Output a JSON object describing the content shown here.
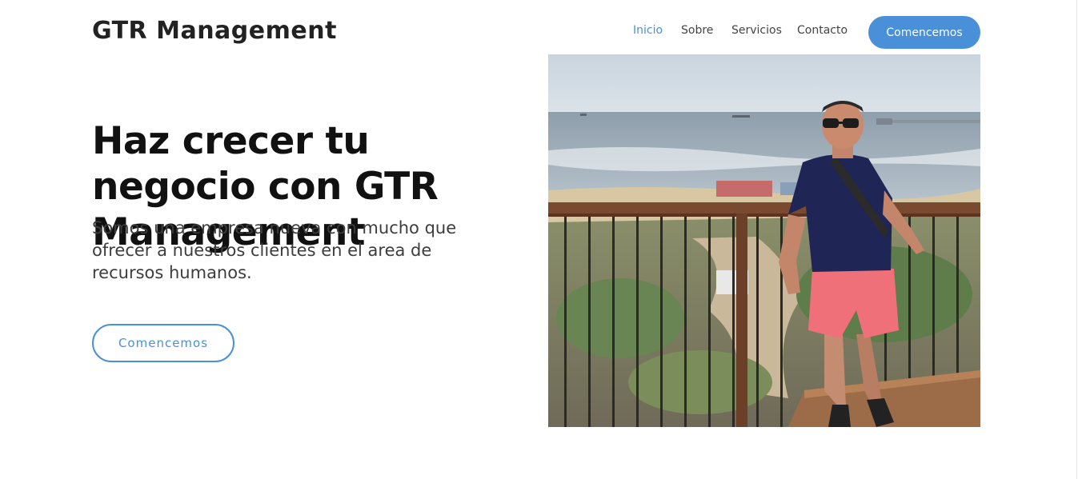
{
  "header": {
    "brand": "GTR Management",
    "nav": [
      {
        "label": "Inicio",
        "active": true
      },
      {
        "label": "Sobre",
        "active": false
      },
      {
        "label": "Servicios",
        "active": false
      },
      {
        "label": "Contacto",
        "active": false
      }
    ],
    "cta_label": "Comencemos"
  },
  "hero": {
    "title": "Haz crecer tu negocio con GTR Management",
    "subtitle": "Somos una empresa nueva con mucho que ofrecer a nuestros clientes en el area de recursos humanos.",
    "cta_label": "Comencemos",
    "image": {
      "icon": "hero-photo-man-at-seaside-railing"
    }
  },
  "colors": {
    "accent": "#4a90d9",
    "text_dark": "#111111",
    "text_body": "#3d3d3d"
  }
}
